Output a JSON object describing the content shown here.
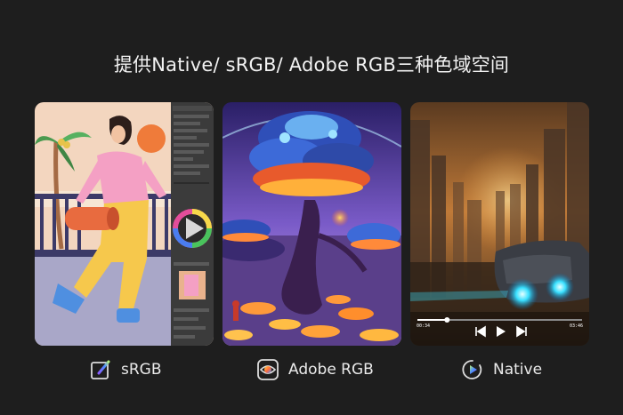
{
  "headline": "提供Native/ sRGB/ Adobe RGB三种色域空间",
  "panels": [
    {
      "caption": "sRGB",
      "icon": "edit-square-icon"
    },
    {
      "caption": "Adobe RGB",
      "icon": "eye-icon"
    },
    {
      "caption": "Native",
      "icon": "play-circle-icon"
    }
  ],
  "video_player": {
    "elapsed": "00:34",
    "duration": "03:46",
    "progress": 0.18
  },
  "colors": {
    "background": "#1e1e1e",
    "icon_gradient_start": "#b6f27a",
    "icon_gradient_mid": "#4d8cff",
    "icon_gradient_end": "#8a5cff"
  }
}
